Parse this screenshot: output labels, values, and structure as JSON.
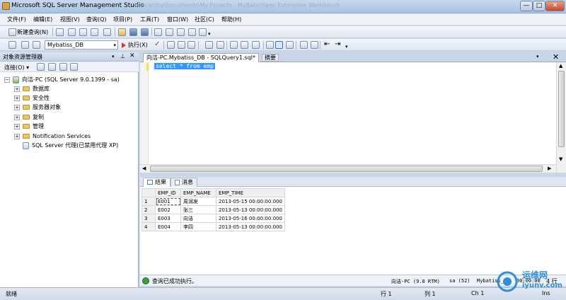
{
  "window": {
    "title": "Microsoft SQL Server Management Studio",
    "title_ghost": "\\Hierarchy\\Documents\\My Projects - MyBatis\\Spec Enterprise Workbench",
    "controls": [
      "—",
      "□",
      "✕"
    ]
  },
  "menubar": [
    "文件(F)",
    "编辑(E)",
    "视图(V)",
    "查询(Q)",
    "项目(P)",
    "工具(T)",
    "窗口(W)",
    "社区(C)",
    "帮助(H)"
  ],
  "toolbar": {
    "new_query": "新建查询(N)",
    "database": "Mybatiss_DB",
    "execute": "执行(X)"
  },
  "object_explorer": {
    "title": "对象资源管理器",
    "connect": "连接(O) ▾",
    "server": "向洁-PC (SQL Server 9.0.1399 - sa)",
    "nodes": [
      "数据库",
      "安全性",
      "服务器对象",
      "复制",
      "管理",
      "Notification Services"
    ],
    "agent": "SQL Server 代理(已禁用代理 XP)"
  },
  "editor": {
    "tab": "向洁-PC.Mybatiss_DB - SQLQuery1.sql*",
    "summary_tab": "摘要",
    "sql": "select * from emp"
  },
  "results": {
    "tabs": [
      "结果",
      "消息"
    ],
    "columns": [
      "EMP_ID",
      "EMP_NAME",
      "EMP_TIME"
    ],
    "rows": [
      [
        "1",
        "E001",
        "周润发",
        "2013-05-15 00:00:00.000"
      ],
      [
        "2",
        "E002",
        "张三",
        "2013-05-13 00:00:00.000"
      ],
      [
        "3",
        "E003",
        "向洁",
        "2013-05-16 00:00:00.000"
      ],
      [
        "4",
        "E004",
        "李四",
        "2013-05-13 00:00:00.000"
      ]
    ]
  },
  "status": {
    "message": "查询已成功执行。",
    "server": "向洁-PC (9.0 RTM)",
    "user": "sa (52)",
    "database": "Mybatiss_DB",
    "time": "00:00:00",
    "rows": "4 行"
  },
  "bottom": {
    "ready": "就绪",
    "line": "行 1",
    "col": "列 1",
    "ch": "Ch 1",
    "mode": "Ins"
  },
  "watermark": {
    "brand": "运维网",
    "url": "iyunv.com"
  },
  "colors": {
    "selection": "#3399ff",
    "chrome": "#c9d6e8",
    "ok": "#3b9d3b"
  }
}
